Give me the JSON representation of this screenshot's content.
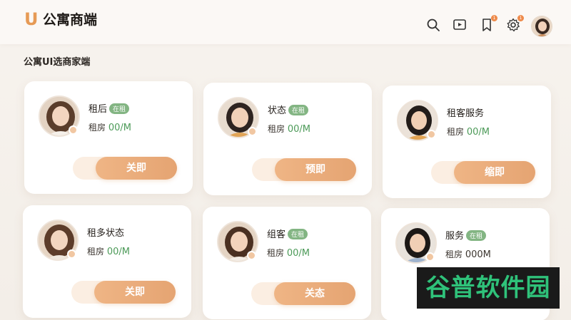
{
  "header": {
    "logo": "U",
    "title": "公寓商端",
    "icons": [
      "search-icon",
      "play-icon",
      "bookmark-icon",
      "gear-icon"
    ],
    "bookmark_badge": "1",
    "gear_badge": "1"
  },
  "section": {
    "title": "公寓UI选商家端"
  },
  "cards": [
    {
      "title": "租后",
      "tag": "在租",
      "price_label": "租房 ",
      "price_value": "00/M",
      "button": "关即"
    },
    {
      "title": "状态",
      "tag": "在租",
      "price_label": "租房 ",
      "price_value": "00/M",
      "button": "预即"
    },
    {
      "title": "租客服务",
      "tag": "",
      "price_label": "租房 ",
      "price_value": "00/M",
      "button": "缩即"
    },
    {
      "title": "租多状态",
      "tag": "",
      "price_label": "租房 ",
      "price_value": "00/M",
      "button": "关即"
    },
    {
      "title": "组客",
      "tag": "在租",
      "price_label": "租房 ",
      "price_value": "00/M",
      "button": "关态"
    },
    {
      "title": "服务",
      "tag": "在租",
      "price_label": "租房 ",
      "price_value": "000M",
      "button": ""
    }
  ],
  "watermark": "谷普软件园",
  "colors": {
    "accent": "#e69a55",
    "tag": "#83b583",
    "price": "#4c9a58"
  }
}
